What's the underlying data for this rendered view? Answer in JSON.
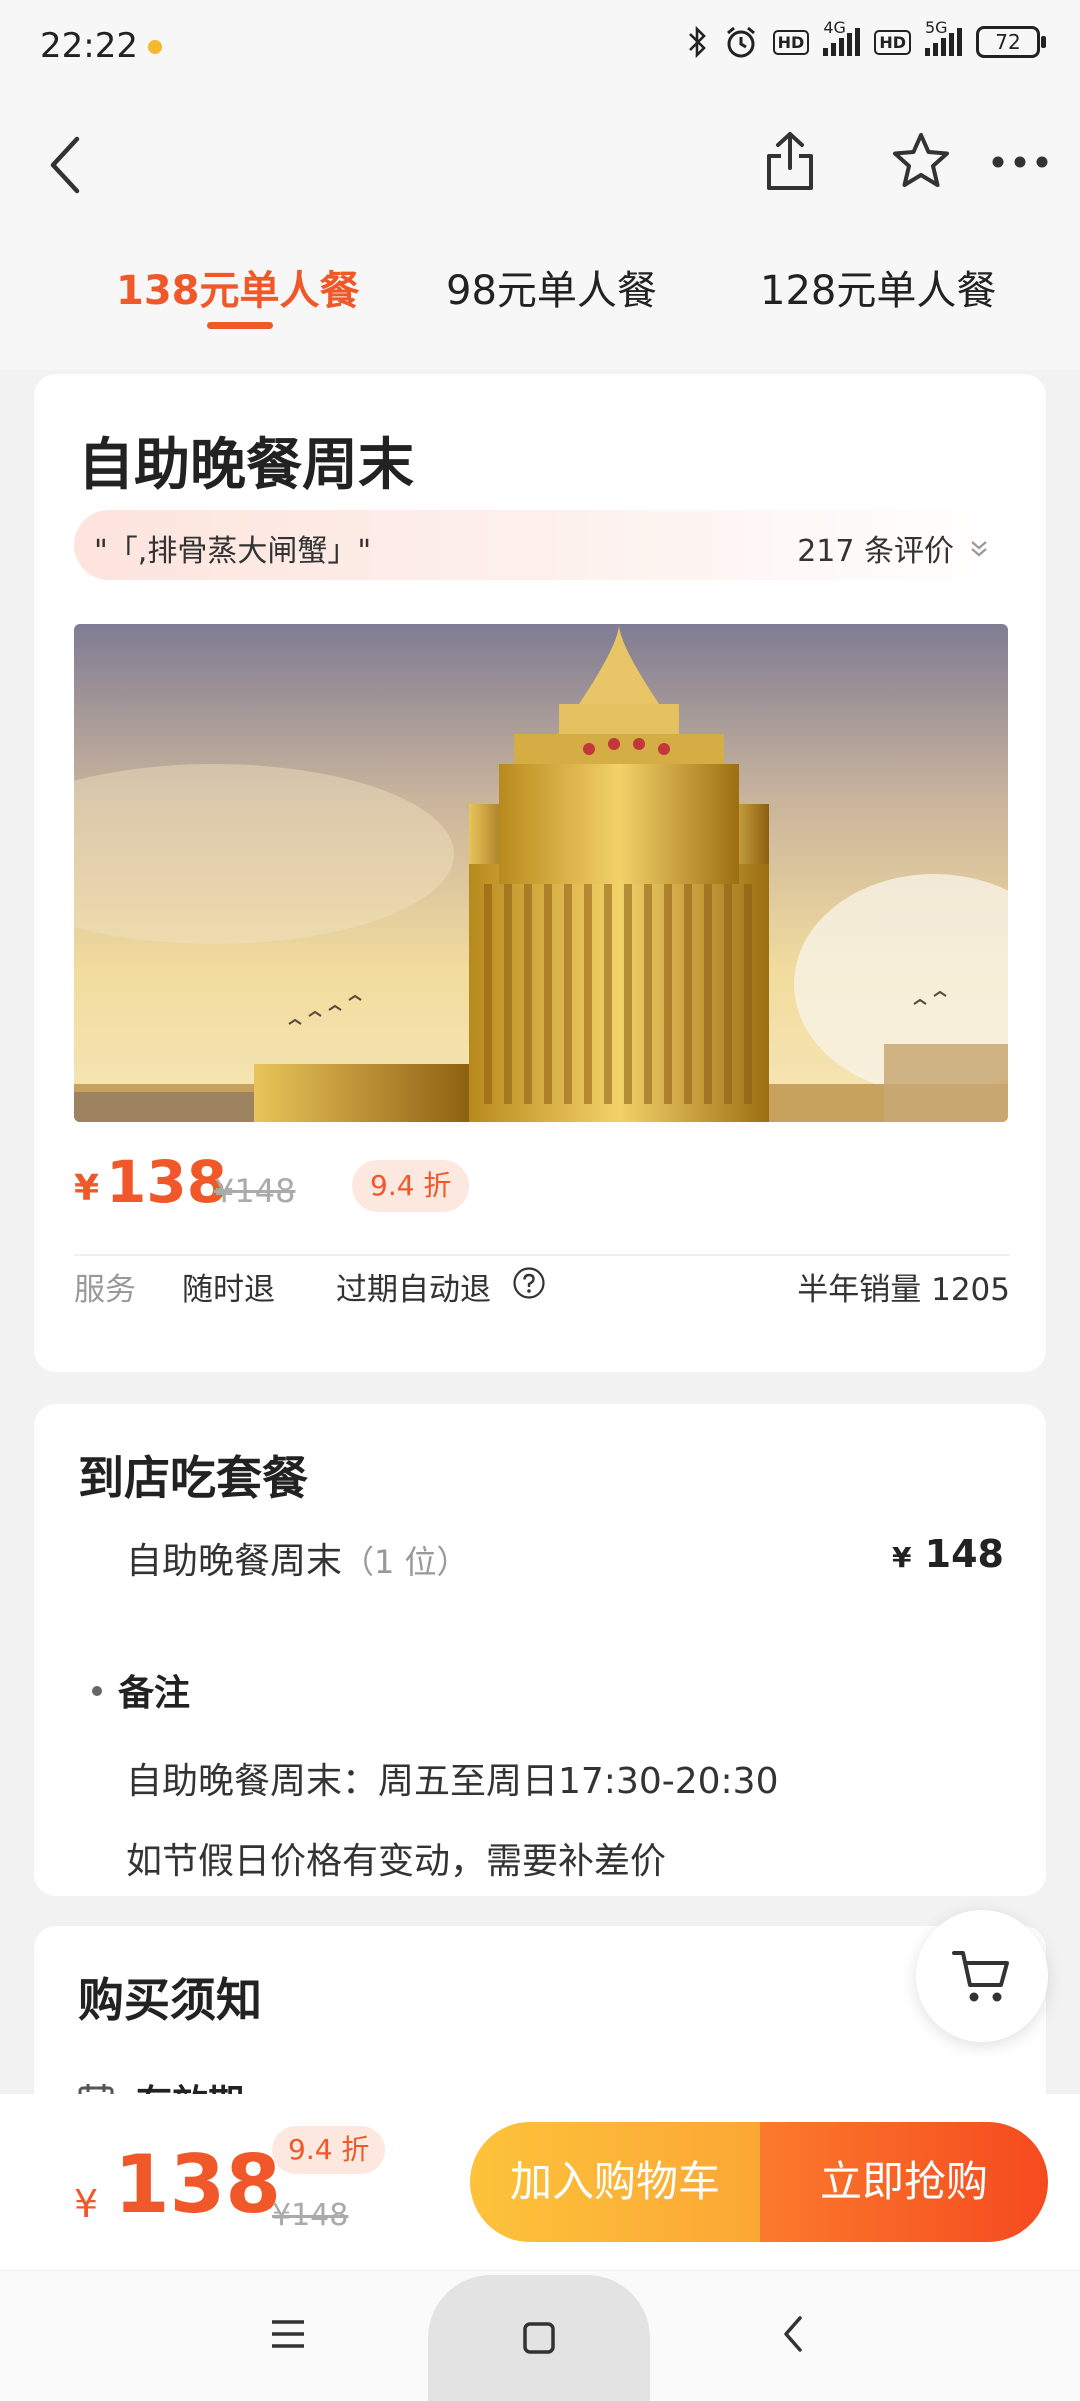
{
  "status_bar": {
    "time": "22:22",
    "network_a": "4G",
    "network_b": "5G",
    "hd": "HD",
    "battery": "72"
  },
  "header": {
    "icons": [
      "back-icon",
      "share-icon",
      "star-icon",
      "more-icon"
    ],
    "tabs": [
      {
        "label": "138元单人餐",
        "active": true
      },
      {
        "label": "98元单人餐",
        "active": false
      },
      {
        "label": "128元单人餐",
        "active": false
      }
    ]
  },
  "deal": {
    "title": "自助晚餐周末",
    "quote": "\"「,排骨蒸大闸蟹」\"",
    "reviews": "217 条评价",
    "price_symbol": "¥",
    "price": "138",
    "original_price": "¥148",
    "discount": "9.4 折",
    "service_label": "服务",
    "service_a": "随时退",
    "service_b": "过期自动退",
    "sales": "半年销量 1205"
  },
  "package": {
    "heading": "到店吃套餐",
    "item_name": "自助晚餐周末",
    "item_qty": "（1 位）",
    "item_price_symbol": "¥",
    "item_price": "148",
    "note_heading": "备注",
    "note_lines": [
      "自助晚餐周末：周五至周日17:30-20:30",
      "如节假日价格有变动，需要补差价"
    ]
  },
  "purchase_notice": {
    "heading": "购买须知",
    "sub_heading": "有效期"
  },
  "bottom_bar": {
    "price_symbol": "¥",
    "price": "138",
    "discount": "9.4 折",
    "original_price": "¥148",
    "add_to_cart": "加入购物车",
    "buy_now": "立即抢购"
  },
  "colors": {
    "accent": "#f0582a",
    "cart_button": "#fdbb38",
    "buy_button": "#f54a1f"
  }
}
